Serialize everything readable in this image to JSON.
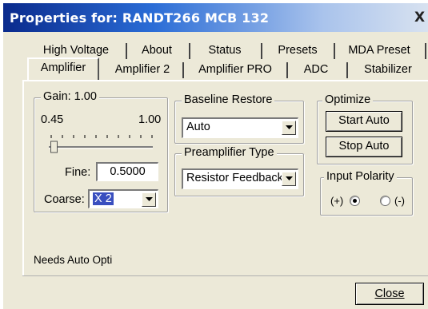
{
  "window": {
    "title": "Properties for: RANDT266 MCB 132",
    "close_glyph": "X"
  },
  "tabs_row1": [
    "High Voltage",
    "About",
    "Status",
    "Presets",
    "MDA Preset"
  ],
  "tabs_row2": [
    "Amplifier",
    "Amplifier 2",
    "Amplifier PRO",
    "ADC",
    "Stabilizer"
  ],
  "active_tab": "Amplifier",
  "gain": {
    "legend": "Gain: 1.00",
    "min_label": "0.45",
    "max_label": "1.00",
    "slider_position_fraction": 0.05,
    "fine_label": "Fine:",
    "fine_value": "0.5000",
    "coarse_label": "Coarse:",
    "coarse_value": "X 2"
  },
  "baseline_restore": {
    "legend": "Baseline Restore",
    "value": "Auto"
  },
  "preamplifier_type": {
    "legend": "Preamplifier Type",
    "value": "Resistor Feedback"
  },
  "optimize": {
    "legend": "Optimize",
    "start_label": "Start Auto",
    "stop_label": "Stop Auto"
  },
  "input_polarity": {
    "legend": "Input Polarity",
    "positive_label": "(+)",
    "negative_label": "(-)",
    "selected": "positive"
  },
  "status_text": "Needs Auto Opti",
  "close_button": {
    "label": "Close"
  },
  "colors": {
    "title_bar_start": "#0a2a8c",
    "title_bar_end": "#d8e2f0",
    "selection": "#3a4fbf",
    "dialog_bg": "#ece9d8"
  }
}
